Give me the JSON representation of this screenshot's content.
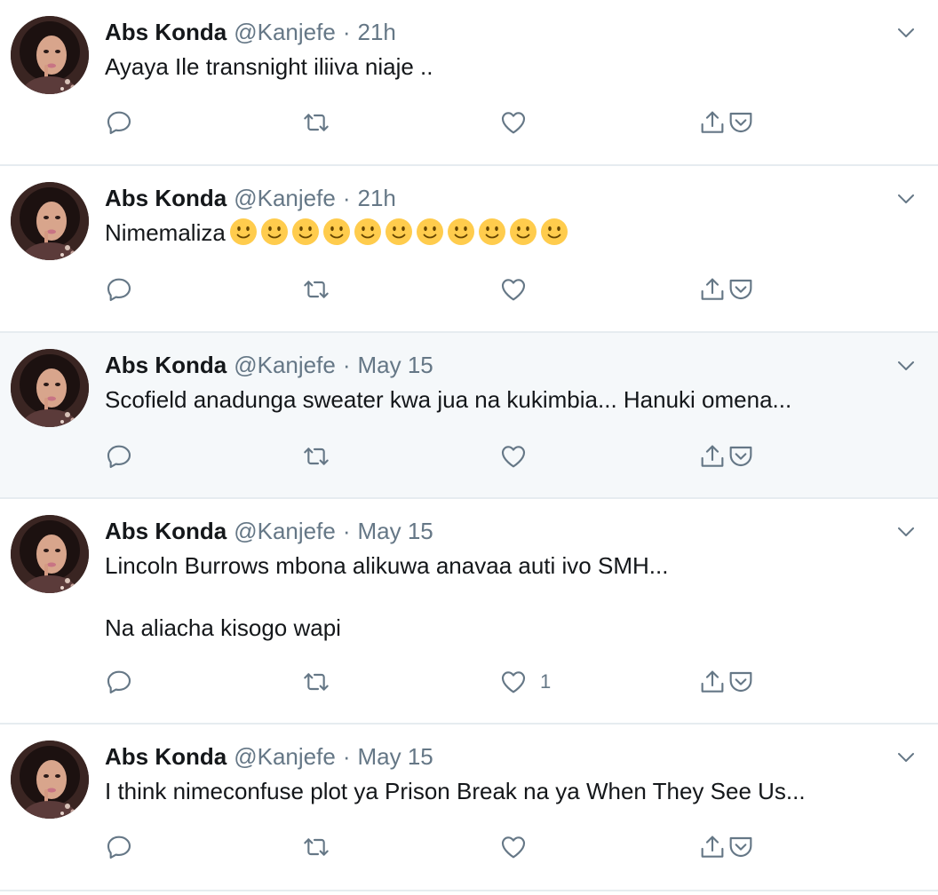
{
  "tweets": [
    {
      "name": "Abs Konda",
      "handle": "@Kanjefe",
      "separator": "·",
      "time": "21h",
      "paragraphs": [
        "Ayaya Ile transnight iliiva niaje .."
      ],
      "likes": ""
    },
    {
      "name": "Abs Konda",
      "handle": "@Kanjefe",
      "separator": "·",
      "time": "21h",
      "paragraphs": [
        "Nimemaliza"
      ],
      "emoji": "slightly-smiling-face",
      "emoji_count": 11,
      "likes": ""
    },
    {
      "name": "Abs Konda",
      "handle": "@Kanjefe",
      "separator": "·",
      "time": "May 15",
      "paragraphs": [
        "Scofield anadunga sweater kwa jua na kukimbia... Hanuki omena..."
      ],
      "likes": ""
    },
    {
      "name": "Abs Konda",
      "handle": "@Kanjefe",
      "separator": "·",
      "time": "May 15",
      "paragraphs": [
        "Lincoln Burrows mbona alikuwa anavaa auti ivo SMH...",
        "Na aliacha kisogo wapi"
      ],
      "likes": "1"
    },
    {
      "name": "Abs Konda",
      "handle": "@Kanjefe",
      "separator": "·",
      "time": "May 15",
      "paragraphs": [
        "I think nimeconfuse plot ya Prison Break na ya When They See Us..."
      ],
      "likes": ""
    }
  ],
  "icons": {
    "reply": "reply-icon",
    "retweet": "retweet-icon",
    "like": "heart-icon",
    "share": "share-icon",
    "save": "pocket-icon",
    "caret": "chevron-down-icon"
  },
  "colors": {
    "text": "#14171a",
    "secondary": "#657786",
    "divider": "#e6ecf0",
    "highlight_bg": "#f5f8fa",
    "emoji_face": "#ffcc4d"
  }
}
